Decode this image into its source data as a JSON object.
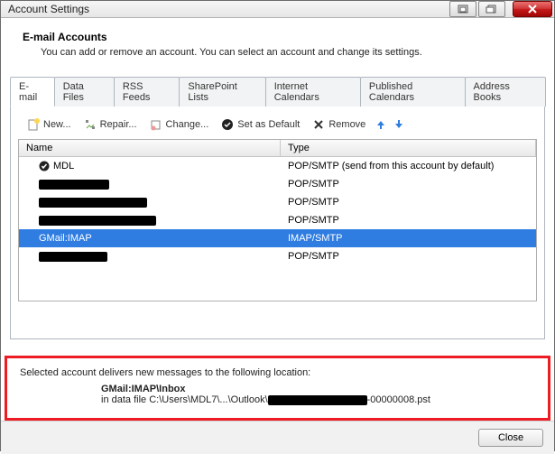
{
  "window": {
    "title": "Account Settings"
  },
  "header": {
    "title": "E-mail Accounts",
    "subtitle": "You can add or remove an account. You can select an account and change its settings."
  },
  "tabs": [
    {
      "label": "E-mail",
      "active": true
    },
    {
      "label": "Data Files"
    },
    {
      "label": "RSS Feeds"
    },
    {
      "label": "SharePoint Lists"
    },
    {
      "label": "Internet Calendars"
    },
    {
      "label": "Published Calendars"
    },
    {
      "label": "Address Books"
    }
  ],
  "toolbar": {
    "new": "New...",
    "repair": "Repair...",
    "change": "Change...",
    "set_default": "Set as Default",
    "remove": "Remove"
  },
  "columns": {
    "name": "Name",
    "type": "Type"
  },
  "accounts": [
    {
      "name": "MDL",
      "type": "POP/SMTP (send from this account by default)",
      "default": true,
      "redactedW": 0
    },
    {
      "name": "",
      "type": "POP/SMTP",
      "redactedW": 78
    },
    {
      "name": "",
      "type": "POP/SMTP",
      "redactedW": 120
    },
    {
      "name": "",
      "type": "POP/SMTP",
      "redactedW": 130
    },
    {
      "name": "GMail:IMAP",
      "type": "IMAP/SMTP",
      "selected": true,
      "redactedW": 0
    },
    {
      "name": "",
      "type": "POP/SMTP",
      "redactedW": 76
    }
  ],
  "info": {
    "lead": "Selected account delivers new messages to the following location:",
    "loc_name": "GMail:IMAP\\Inbox",
    "loc_prefix": "in data file C:\\Users\\MDL7\\...\\Outlook\\",
    "loc_suffix": "-00000008.pst"
  },
  "buttons": {
    "close": "Close"
  }
}
